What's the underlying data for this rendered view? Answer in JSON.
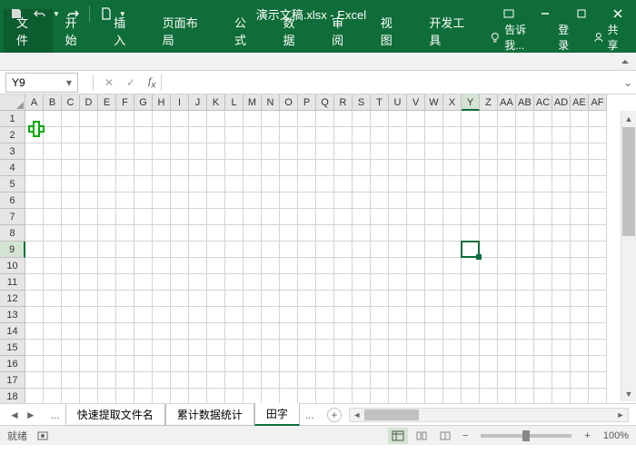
{
  "title": "演示文稿.xlsx - Excel",
  "qat": {
    "save": "save",
    "undo": "undo",
    "redo": "redo",
    "new": "new"
  },
  "tabs": {
    "file": "文件",
    "home": "开始",
    "insert": "插入",
    "layout": "页面布局",
    "formulas": "公式",
    "data": "数据",
    "review": "审阅",
    "view": "视图",
    "dev": "开发工具"
  },
  "tellme": "告诉我...",
  "signin": "登录",
  "share": "共享",
  "namebox": "Y9",
  "formula": "",
  "columns": [
    "A",
    "B",
    "C",
    "D",
    "E",
    "F",
    "G",
    "H",
    "I",
    "J",
    "K",
    "L",
    "M",
    "N",
    "O",
    "P",
    "Q",
    "R",
    "S",
    "T",
    "U",
    "V",
    "W",
    "X",
    "Y",
    "Z",
    "AA",
    "AB",
    "AC",
    "AD",
    "AE",
    "AF"
  ],
  "selected_col_index": 24,
  "selected_row_index": 8,
  "row_count": 18,
  "sheets": {
    "s1": "快速提取文件名",
    "s2": "累计数据统计",
    "s3": "田字"
  },
  "active_sheet": 2,
  "status": {
    "ready": "就绪",
    "zoom": "100%"
  }
}
